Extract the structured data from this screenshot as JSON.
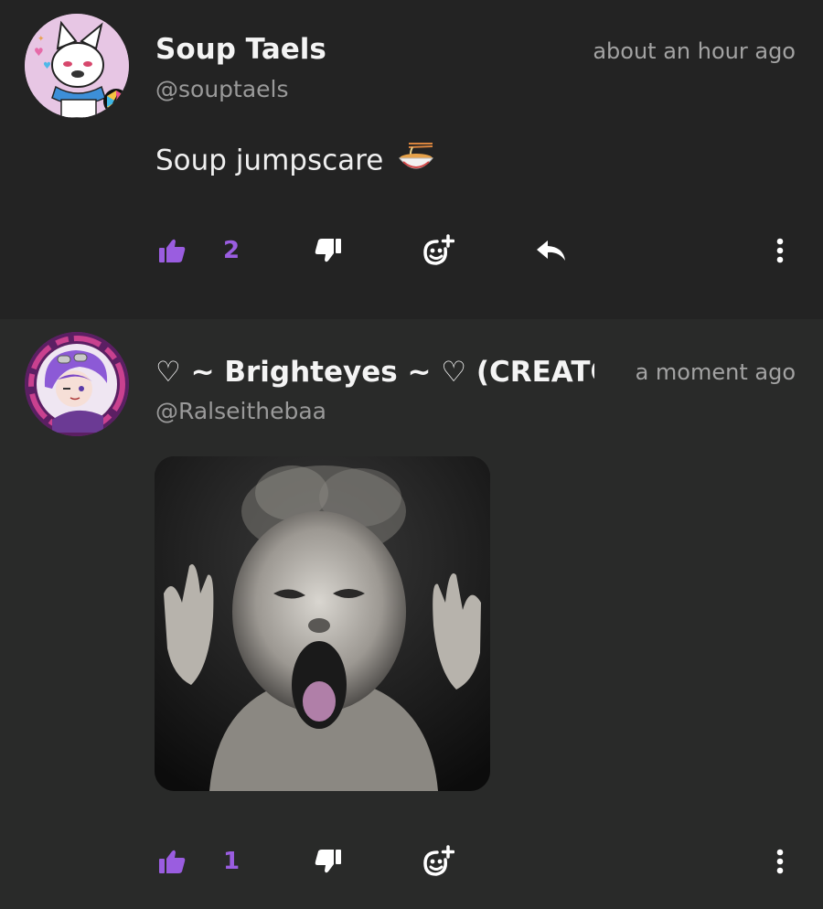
{
  "colors": {
    "accent": "#9a5de0",
    "text": "#f4f4f4",
    "muted": "#9a9a9a"
  },
  "posts": [
    {
      "author": "Soup Taels",
      "handle": "@souptaels",
      "time": "about an hour ago",
      "text": "Soup jumpscare",
      "emoji": "ramen-bowl-icon",
      "likes": "2"
    },
    {
      "author": "♡ ~ Brighteyes ~ ♡ (CREATOR)",
      "handle": "@Ralseithebaa",
      "time": "a moment ago",
      "likes": "1"
    }
  ]
}
